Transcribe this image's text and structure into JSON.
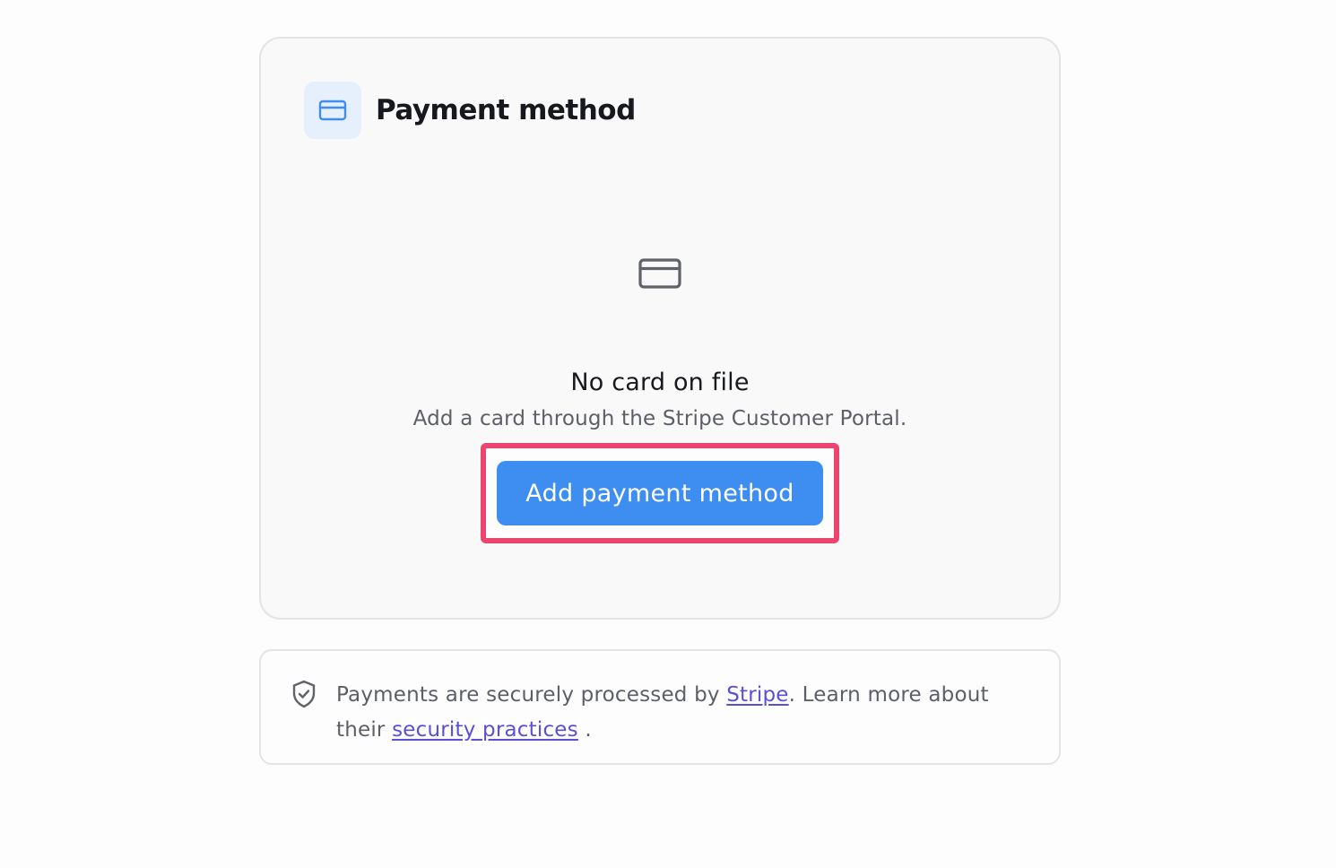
{
  "payment_card": {
    "title": "Payment method",
    "header_icon": "credit-card-icon",
    "empty_state": {
      "icon": "credit-card-icon",
      "title": "No card on file",
      "subtitle": "Add a card through the Stripe Customer Portal.",
      "button_label": "Add payment method"
    }
  },
  "security_note": {
    "icon": "shield-check-icon",
    "text_before": "Payments are securely processed by ",
    "stripe_link": "Stripe",
    "text_middle": ". Learn more about their ",
    "practices_link": "security practices",
    "text_after": " ."
  },
  "colors": {
    "accent_blue": "#3e8ef2",
    "highlight_pink": "#ec456f",
    "link_purple": "#5b4fd6",
    "icon_box_bg": "#e6effc"
  }
}
